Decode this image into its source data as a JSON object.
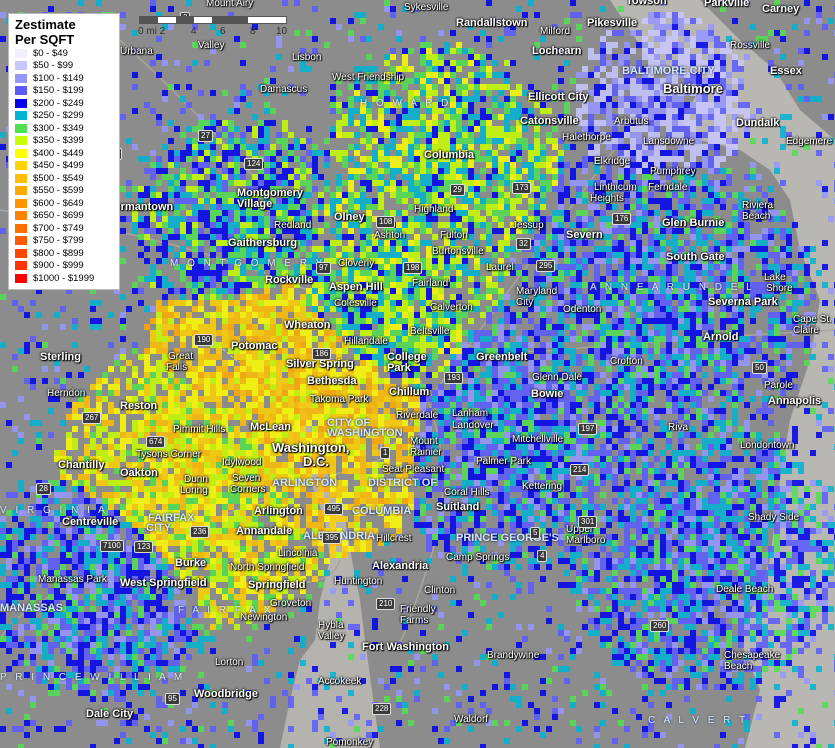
{
  "legend": {
    "title_line1": "Zestimate",
    "title_line2": "Per SQFT",
    "items": [
      {
        "label": "$0 - $49",
        "color": "#f0f0ff"
      },
      {
        "label": "$50 - $99",
        "color": "#c8c8ff"
      },
      {
        "label": "$100 - $149",
        "color": "#9696ff"
      },
      {
        "label": "$150 - $199",
        "color": "#5a5aff"
      },
      {
        "label": "$200 - $249",
        "color": "#0000f0"
      },
      {
        "label": "$250 - $299",
        "color": "#00b4d2"
      },
      {
        "label": "$300 - $349",
        "color": "#50e050"
      },
      {
        "label": "$350 - $399",
        "color": "#c8ff00"
      },
      {
        "label": "$400 - $449",
        "color": "#ffff00"
      },
      {
        "label": "$450 - $499",
        "color": "#ffd200"
      },
      {
        "label": "$500 - $549",
        "color": "#ffbe00"
      },
      {
        "label": "$550 - $599",
        "color": "#ffaa00"
      },
      {
        "label": "$600 - $649",
        "color": "#ff9600"
      },
      {
        "label": "$650 - $699",
        "color": "#ff8200"
      },
      {
        "label": "$700 - $749",
        "color": "#ff6e00"
      },
      {
        "label": "$750 - $799",
        "color": "#ff5a00"
      },
      {
        "label": "$800 - $899",
        "color": "#ff4600"
      },
      {
        "label": "$900 - $999",
        "color": "#ff3200"
      },
      {
        "label": "$1000 - $1999",
        "color": "#ff0000"
      }
    ]
  },
  "scale": {
    "ticks": [
      "0 mi 2",
      "4",
      "6",
      "8",
      "10"
    ]
  },
  "places": [
    {
      "name": "Mount Airy",
      "cls": ""
    },
    {
      "name": "Sykesville",
      "cls": ""
    },
    {
      "name": "Randallstown",
      "cls": "big"
    },
    {
      "name": "Towson",
      "cls": "big"
    },
    {
      "name": "Parkville",
      "cls": "big"
    },
    {
      "name": "Carney",
      "cls": "big"
    },
    {
      "name": "Milford",
      "cls": ""
    },
    {
      "name": "Pikesville",
      "cls": "big"
    },
    {
      "name": "Lochearn",
      "cls": "big"
    },
    {
      "name": "Rossville",
      "cls": ""
    },
    {
      "name": "Urbana",
      "cls": ""
    },
    {
      "name": "Valley",
      "cls": ""
    },
    {
      "name": "Lisbon",
      "cls": ""
    },
    {
      "name": "West Friendship",
      "cls": ""
    },
    {
      "name": "Essex",
      "cls": "big"
    },
    {
      "name": "Baltimore",
      "cls": "huge"
    },
    {
      "name": "Damascus",
      "cls": ""
    },
    {
      "name": "Ellicott City",
      "cls": "big"
    },
    {
      "name": "Arbutus",
      "cls": ""
    },
    {
      "name": "Dundalk",
      "cls": "big"
    },
    {
      "name": "Catonsville",
      "cls": "big"
    },
    {
      "name": "Halethorpe",
      "cls": ""
    },
    {
      "name": "Lansdowne",
      "cls": ""
    },
    {
      "name": "Edgemere",
      "cls": ""
    },
    {
      "name": "Columbia",
      "cls": "big"
    },
    {
      "name": "Elkridge",
      "cls": ""
    },
    {
      "name": "Pumphrey",
      "cls": ""
    },
    {
      "name": "Linthicum",
      "cls": ""
    },
    {
      "name": "Heights",
      "cls": ""
    },
    {
      "name": "Ferndale",
      "cls": ""
    },
    {
      "name": "Montgomery",
      "cls": "big"
    },
    {
      "name": "Village",
      "cls": "big"
    },
    {
      "name": "Germantown",
      "cls": "big"
    },
    {
      "name": "Riviera",
      "cls": ""
    },
    {
      "name": "Beach",
      "cls": ""
    },
    {
      "name": "Highland",
      "cls": ""
    },
    {
      "name": "Olney",
      "cls": "big"
    },
    {
      "name": "Redland",
      "cls": ""
    },
    {
      "name": "Jessup",
      "cls": ""
    },
    {
      "name": "Glen Burnie",
      "cls": "big"
    },
    {
      "name": "Severn",
      "cls": "big"
    },
    {
      "name": "Ashton",
      "cls": ""
    },
    {
      "name": "Fulton",
      "cls": ""
    },
    {
      "name": "Gaithersburg",
      "cls": "big"
    },
    {
      "name": "Burtonsville",
      "cls": ""
    },
    {
      "name": "South Gate",
      "cls": "big"
    },
    {
      "name": "Cloverly",
      "cls": ""
    },
    {
      "name": "Laurel",
      "cls": ""
    },
    {
      "name": "Rockville",
      "cls": "big"
    },
    {
      "name": "Lake",
      "cls": ""
    },
    {
      "name": "Shore",
      "cls": ""
    },
    {
      "name": "Fairland",
      "cls": ""
    },
    {
      "name": "Aspen Hill",
      "cls": "big"
    },
    {
      "name": "Maryland",
      "cls": ""
    },
    {
      "name": "City",
      "cls": ""
    },
    {
      "name": "Colesville",
      "cls": ""
    },
    {
      "name": "Severna Park",
      "cls": "big"
    },
    {
      "name": "Calverton",
      "cls": ""
    },
    {
      "name": "Odenton",
      "cls": ""
    },
    {
      "name": "Cape St.",
      "cls": ""
    },
    {
      "name": "Claire",
      "cls": ""
    },
    {
      "name": "Wheaton",
      "cls": "big"
    },
    {
      "name": "Beltsville",
      "cls": ""
    },
    {
      "name": "Hillandale",
      "cls": ""
    },
    {
      "name": "Arnold",
      "cls": "big"
    },
    {
      "name": "Potomac",
      "cls": "big"
    },
    {
      "name": "Crofton",
      "cls": ""
    },
    {
      "name": "Sterling",
      "cls": "big"
    },
    {
      "name": "Great",
      "cls": ""
    },
    {
      "name": "Falls",
      "cls": ""
    },
    {
      "name": "College",
      "cls": "big"
    },
    {
      "name": "Park",
      "cls": "big"
    },
    {
      "name": "Greenbelt",
      "cls": "big"
    },
    {
      "name": "Silver Spring",
      "cls": "big"
    },
    {
      "name": "Herndon",
      "cls": ""
    },
    {
      "name": "Bethesda",
      "cls": "big"
    },
    {
      "name": "Glenn Dale",
      "cls": ""
    },
    {
      "name": "Parole",
      "cls": ""
    },
    {
      "name": "Chillum",
      "cls": "big"
    },
    {
      "name": "Takoma Park",
      "cls": ""
    },
    {
      "name": "Annapolis",
      "cls": "big"
    },
    {
      "name": "Reston",
      "cls": "big"
    },
    {
      "name": "Bowie",
      "cls": "big"
    },
    {
      "name": "Riverdale",
      "cls": ""
    },
    {
      "name": "Lanham",
      "cls": ""
    },
    {
      "name": "Landover",
      "cls": ""
    },
    {
      "name": "McLean",
      "cls": "big"
    },
    {
      "name": "Pimmit Hills",
      "cls": ""
    },
    {
      "name": "Riva",
      "cls": ""
    },
    {
      "name": "Mitchellville",
      "cls": ""
    },
    {
      "name": "Mount",
      "cls": ""
    },
    {
      "name": "Rainier",
      "cls": ""
    },
    {
      "name": "Washington,",
      "cls": "huge"
    },
    {
      "name": "D.C.",
      "cls": "huge"
    },
    {
      "name": "Londontown",
      "cls": ""
    },
    {
      "name": "Tysons Corner",
      "cls": ""
    },
    {
      "name": "Idylwood",
      "cls": ""
    },
    {
      "name": "Palmer Park",
      "cls": ""
    },
    {
      "name": "Seat Pleasant",
      "cls": ""
    },
    {
      "name": "Chantilly",
      "cls": "big"
    },
    {
      "name": "Oakton",
      "cls": "big"
    },
    {
      "name": "Dunn",
      "cls": ""
    },
    {
      "name": "Loring",
      "cls": ""
    },
    {
      "name": "Seven",
      "cls": ""
    },
    {
      "name": "Corners",
      "cls": ""
    },
    {
      "name": "Kettering",
      "cls": ""
    },
    {
      "name": "Coral Hills",
      "cls": ""
    },
    {
      "name": "Suitland",
      "cls": "big"
    },
    {
      "name": "Arlington",
      "cls": "big"
    },
    {
      "name": "Shady Side",
      "cls": ""
    },
    {
      "name": "Centreville",
      "cls": "big"
    },
    {
      "name": "Annandale",
      "cls": "big"
    },
    {
      "name": "Upper",
      "cls": ""
    },
    {
      "name": "Marlboro",
      "cls": ""
    },
    {
      "name": "Hillcrest",
      "cls": ""
    },
    {
      "name": "Lincolnia",
      "cls": ""
    },
    {
      "name": "Camp Springs",
      "cls": ""
    },
    {
      "name": "Burke",
      "cls": "big"
    },
    {
      "name": "North Springfield",
      "cls": ""
    },
    {
      "name": "Alexandria",
      "cls": "big"
    },
    {
      "name": "Manassas Park",
      "cls": ""
    },
    {
      "name": "West Springfield",
      "cls": "big"
    },
    {
      "name": "Springfield",
      "cls": "big"
    },
    {
      "name": "Huntington",
      "cls": ""
    },
    {
      "name": "Clinton",
      "cls": ""
    },
    {
      "name": "Deale Beach",
      "cls": ""
    },
    {
      "name": "Groveton",
      "cls": ""
    },
    {
      "name": "Friendly",
      "cls": ""
    },
    {
      "name": "Farms",
      "cls": ""
    },
    {
      "name": "Newington",
      "cls": ""
    },
    {
      "name": "Hybla",
      "cls": ""
    },
    {
      "name": "Valley",
      "cls": ""
    },
    {
      "name": "Fort Washington",
      "cls": "big"
    },
    {
      "name": "Brandywine",
      "cls": ""
    },
    {
      "name": "Chesapeake",
      "cls": ""
    },
    {
      "name": "Beach",
      "cls": ""
    },
    {
      "name": "Lorton",
      "cls": ""
    },
    {
      "name": "Accokeek",
      "cls": ""
    },
    {
      "name": "Woodbridge",
      "cls": "big"
    },
    {
      "name": "Dale City",
      "cls": "big"
    },
    {
      "name": "Waldorf",
      "cls": ""
    },
    {
      "name": "Pomonkey",
      "cls": ""
    }
  ],
  "regions": [
    {
      "name": "H O W A R D"
    },
    {
      "name": "M O N T G O M E R Y"
    },
    {
      "name": "A N N E   A R U N D E L"
    },
    {
      "name": "V I R G I N I A"
    },
    {
      "name": "F A I R F A X"
    },
    {
      "name": "P R I N C E   W I L L I A M"
    },
    {
      "name": "C A L V E R T"
    }
  ],
  "jurisdictions": [
    {
      "name": "BALTIMORE CITY"
    },
    {
      "name": "CITY OF"
    },
    {
      "name": "WASHINGTON"
    },
    {
      "name": "DISTRICT OF"
    },
    {
      "name": "COLUMBIA"
    },
    {
      "name": "ARLINGTON"
    },
    {
      "name": "ALEXANDRIA"
    },
    {
      "name": "FAIRFAX"
    },
    {
      "name": "CITY"
    },
    {
      "name": "PRINCE GEORGE'S"
    },
    {
      "name": "MANASSAS"
    }
  ],
  "shields": [
    "27",
    "124",
    "270",
    "108",
    "29",
    "32",
    "295",
    "97",
    "198",
    "193",
    "190",
    "186",
    "197",
    "214",
    "1",
    "50",
    "495",
    "267",
    "674",
    "28",
    "236",
    "123",
    "7100",
    "395",
    "301",
    "5",
    "4",
    "210",
    "260",
    "228",
    "95",
    "173",
    "176",
    "2"
  ]
}
